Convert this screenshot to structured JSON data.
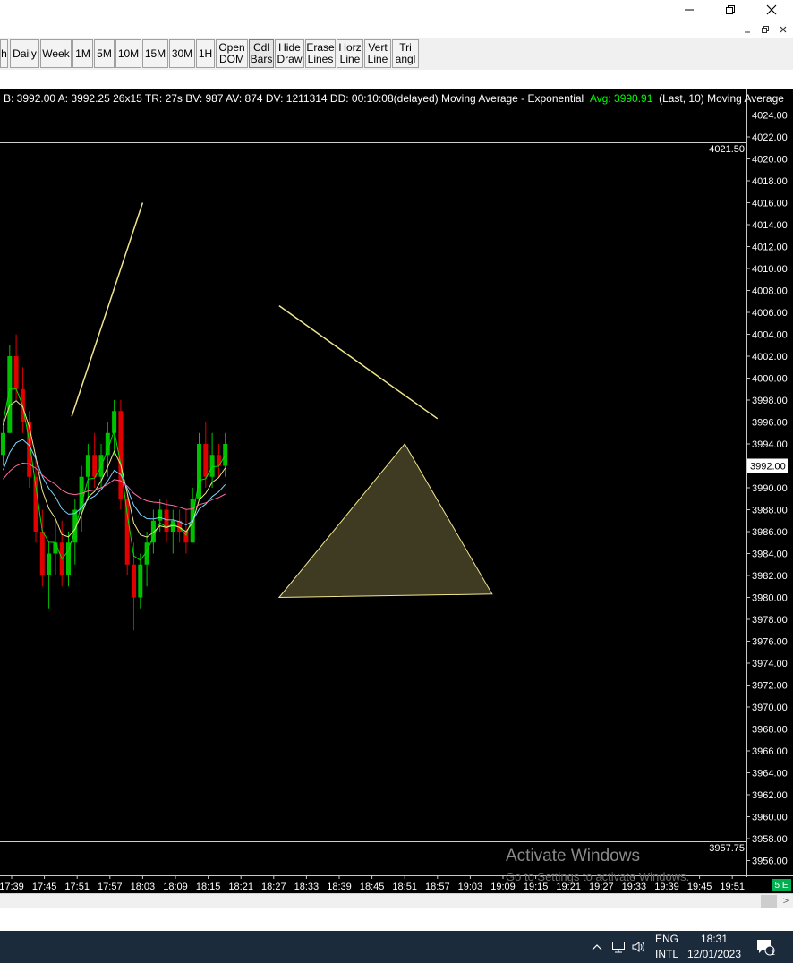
{
  "window_controls": {
    "minimize": "–",
    "maximize": "❐",
    "close": "✕"
  },
  "mdi_controls": {
    "minimize": "–",
    "restore": "❐",
    "close": "✕"
  },
  "toolbar": {
    "buttons": [
      {
        "label": "h",
        "active": false
      },
      {
        "label": "Daily",
        "active": false
      },
      {
        "label": "Week",
        "active": false
      },
      {
        "label": "1M",
        "active": false
      },
      {
        "label": "5M",
        "active": false
      },
      {
        "label": "10M",
        "active": false
      },
      {
        "label": "15M",
        "active": false
      },
      {
        "label": "30M",
        "active": false
      },
      {
        "label": "1H",
        "active": false
      },
      {
        "label": "Open\nDOM",
        "active": false
      },
      {
        "label": "Cdl\nBars",
        "active": true
      },
      {
        "label": "Hide\nDraw",
        "active": false
      },
      {
        "label": "Erase\nLines",
        "active": false
      },
      {
        "label": "Horz\nLine",
        "active": false
      },
      {
        "label": "Vert\nLine",
        "active": false
      },
      {
        "label": "Tri\nangl",
        "active": false
      }
    ]
  },
  "status_line": {
    "quote": "B: 3992.00 A: 3992.25 26x15 TR: 27s BV: 987 AV: 874 DV: 1211314 DD: 00:10:08(delayed) Moving Average - Exponential",
    "avg": "Avg: 3990.91",
    "tail": "(Last, 10)  Moving Average"
  },
  "colors": {
    "chart_bg": "#000000",
    "up_candle": "#00c000",
    "down_candle": "#e00000",
    "drawing_line": "#f0e68c",
    "triangle_fill": "#3f3b22",
    "ma_green": "#00e000",
    "ma_khaki": "#f0e68c",
    "ma_cyan": "#7fd4ff",
    "ma_pink": "#ff6aa0",
    "avg_text": "#00ff00",
    "last_price_bg": "#ffffff"
  },
  "chart_data": {
    "type": "candlestick",
    "y_axis": {
      "ylim": [
        3955,
        4025
      ],
      "ticks": [
        "4024.00",
        "4022.00",
        "4020.00",
        "4018.00",
        "4016.00",
        "4014.00",
        "4012.00",
        "4010.00",
        "4008.00",
        "4006.00",
        "4004.00",
        "4002.00",
        "4000.00",
        "3998.00",
        "3996.00",
        "3994.00",
        "3992.00",
        "3990.00",
        "3988.00",
        "3986.00",
        "3984.00",
        "3982.00",
        "3980.00",
        "3978.00",
        "3976.00",
        "3974.00",
        "3972.00",
        "3970.00",
        "3968.00",
        "3966.00",
        "3964.00",
        "3962.00",
        "3960.00",
        "3958.00",
        "3956.00"
      ],
      "last_price": "3992.00",
      "high_line": "4021.50",
      "low_line": "3957.75"
    },
    "x_axis": {
      "labels": [
        "17:39",
        "17:45",
        "17:51",
        "17:57",
        "18:03",
        "18:09",
        "18:15",
        "18:21",
        "18:27",
        "18:33",
        "18:39",
        "18:45",
        "18:51",
        "18:57",
        "19:03",
        "19:09",
        "19:15",
        "19:21",
        "19:27",
        "19:33",
        "19:39",
        "19:45",
        "19:51"
      ]
    },
    "candles": [
      [
        3993,
        3996,
        3992,
        3995
      ],
      [
        3995,
        4003,
        3995,
        4002
      ],
      [
        4002,
        4004,
        3998,
        3999
      ],
      [
        3999,
        4001,
        3995,
        3996
      ],
      [
        3996,
        3997,
        3990,
        3991
      ],
      [
        3991,
        3993,
        3985,
        3986
      ],
      [
        3986,
        3988,
        3981,
        3982
      ],
      [
        3982,
        3985,
        3979,
        3984
      ],
      [
        3984,
        3987,
        3982,
        3985
      ],
      [
        3985,
        3987,
        3981,
        3982
      ],
      [
        3982,
        3986,
        3981,
        3985
      ],
      [
        3985,
        3989,
        3983,
        3988
      ],
      [
        3988,
        3992,
        3986,
        3991
      ],
      [
        3991,
        3994,
        3989,
        3993
      ],
      [
        3993,
        3995,
        3990,
        3991
      ],
      [
        3991,
        3994,
        3990,
        3993
      ],
      [
        3993,
        3996,
        3991,
        3995
      ],
      [
        3995,
        3998,
        3993,
        3997
      ],
      [
        3997,
        3998,
        3988,
        3989
      ],
      [
        3989,
        3990,
        3982,
        3983
      ],
      [
        3983,
        3985,
        3977,
        3980
      ],
      [
        3980,
        3984,
        3979,
        3983
      ],
      [
        3983,
        3986,
        3981,
        3985
      ],
      [
        3985,
        3988,
        3984,
        3987
      ],
      [
        3987,
        3989,
        3986,
        3988
      ],
      [
        3988,
        3989,
        3985,
        3986
      ],
      [
        3986,
        3988,
        3984,
        3987
      ],
      [
        3987,
        3988,
        3985,
        3986
      ],
      [
        3986,
        3988,
        3984,
        3985
      ],
      [
        3985,
        3990,
        3985,
        3989
      ],
      [
        3989,
        3995,
        3989,
        3994
      ],
      [
        3994,
        3996,
        3990,
        3991
      ],
      [
        3991,
        3995,
        3990,
        3993
      ],
      [
        3993,
        3994,
        3991,
        3992
      ],
      [
        3992,
        3995,
        3991,
        3994
      ]
    ],
    "drawings": {
      "lines": [
        {
          "from": [
            "17:50",
            3996.5
          ],
          "to": [
            "18:03",
            4016.0
          ]
        },
        {
          "from": [
            "18:28",
            4006.6
          ],
          "to": [
            "18:57",
            3996.3
          ]
        }
      ],
      "triangle": [
        [
          "18:28",
          3980.0
        ],
        [
          "18:51",
          3994.0
        ],
        [
          "19:07",
          3980.3
        ]
      ]
    }
  },
  "watermark": {
    "title": "Activate Windows",
    "subtitle": "Go to Settings to activate Windows."
  },
  "badge": "5 E",
  "scrollbar": {
    "right_arrow": ">"
  },
  "taskbar": {
    "chevron": "^",
    "lang_top": "ENG",
    "lang_bottom": "INTL",
    "time": "18:31",
    "date": "12/01/2023",
    "notification_count": "1"
  }
}
